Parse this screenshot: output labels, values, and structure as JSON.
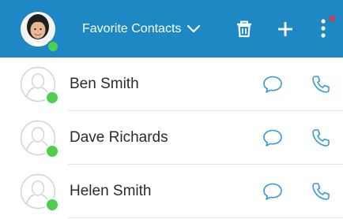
{
  "header": {
    "title": "Favorite Contacts",
    "background": "#1d88c4",
    "icons": [
      "user-avatar",
      "chevron-down-icon",
      "trash-icon",
      "plus-icon",
      "more-vertical-icon"
    ],
    "notification_dot_color": "#e8343d"
  },
  "contacts": [
    {
      "name": "Ben Smith",
      "status": "online"
    },
    {
      "name": "Dave Richards",
      "status": "online"
    },
    {
      "name": "Helen Smith",
      "status": "online"
    }
  ],
  "colors": {
    "online": "#4cd04c",
    "action_icon": "#2f9ad6"
  }
}
